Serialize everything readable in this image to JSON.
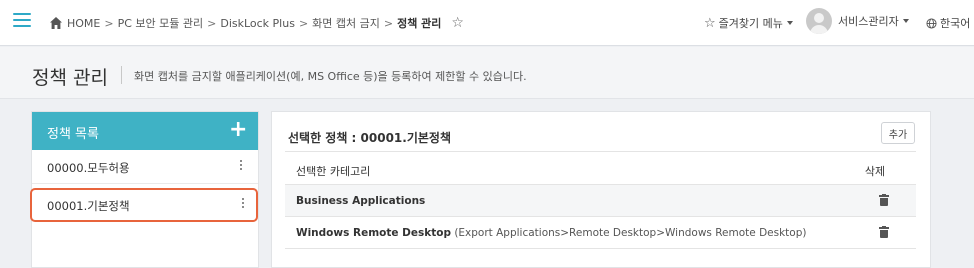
{
  "breadcrumb": {
    "items": [
      "HOME",
      "PC 보안 모듈 관리",
      "DiskLock Plus",
      "화면 캡처 금지"
    ],
    "separator": ">",
    "current": "정책 관리"
  },
  "header": {
    "favorites_label": "즐겨찾기 메뉴",
    "user_name": "서비스관리자",
    "language": "한국어"
  },
  "page": {
    "title": "정책 관리",
    "description": "화면 캡처를 금지할 애플리케이션(예, MS Office 등)을 등록하여 제한할 수 있습니다."
  },
  "policy_list": {
    "title": "정책 목록",
    "items": [
      {
        "label": "00000.모두허용",
        "selected": false
      },
      {
        "label": "00001.기본정책",
        "selected": true
      }
    ]
  },
  "detail": {
    "selected_label": "선택한 정책 : 00001.기본정책",
    "add_button": "추가",
    "columns": [
      "선택한 카테고리",
      "삭제"
    ],
    "rows": [
      {
        "name": "Business Applications",
        "path": ""
      },
      {
        "name": "Windows Remote Desktop",
        "path": "(Export Applications>Remote Desktop>Windows Remote Desktop)"
      }
    ]
  },
  "colors": {
    "accent": "#3fb2c5",
    "selected_border": "#e8643c"
  },
  "icons": [
    "menu-icon",
    "home-icon",
    "star-icon",
    "favorite-star-icon",
    "avatar-icon",
    "globe-icon",
    "plus-icon",
    "kebab-icon",
    "trash-icon"
  ]
}
